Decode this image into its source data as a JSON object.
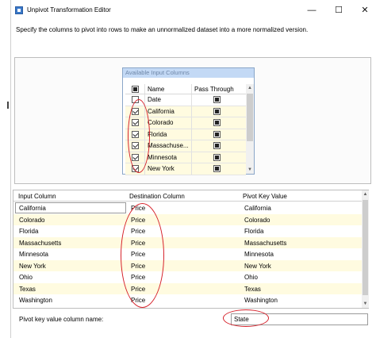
{
  "window": {
    "title": "Unpivot Transformation Editor",
    "minimize": "—",
    "maximize": "☐",
    "close": "✕"
  },
  "description": "Specify the columns to pivot into rows to make an unnormalized dataset into a more normalized version.",
  "available_columns": {
    "title": "Available Input Columns",
    "headers": {
      "name": "Name",
      "pass_through": "Pass Through"
    },
    "rows": [
      {
        "name": "Date",
        "checked": false,
        "pass_through": true
      },
      {
        "name": "California",
        "checked": true,
        "pass_through": true
      },
      {
        "name": "Colorado",
        "checked": true,
        "pass_through": true
      },
      {
        "name": "Florida",
        "checked": true,
        "pass_through": true
      },
      {
        "name": "Massachuse...",
        "checked": true,
        "pass_through": true
      },
      {
        "name": "Minnesota",
        "checked": true,
        "pass_through": true
      },
      {
        "name": "New York",
        "checked": true,
        "pass_through": true
      }
    ]
  },
  "grid": {
    "headers": {
      "input": "Input Column",
      "destination": "Destination Column",
      "pivot": "Pivot Key Value"
    },
    "rows": [
      {
        "input": "California",
        "destination": "Price",
        "pivot": "California"
      },
      {
        "input": "Colorado",
        "destination": "Price",
        "pivot": "Colorado"
      },
      {
        "input": "Florida",
        "destination": "Price",
        "pivot": "Florida"
      },
      {
        "input": "Massachusetts",
        "destination": "Price",
        "pivot": "Massachusetts"
      },
      {
        "input": "Minnesota",
        "destination": "Price",
        "pivot": "Minnesota"
      },
      {
        "input": "New York",
        "destination": "Price",
        "pivot": "New York"
      },
      {
        "input": "Ohio",
        "destination": "Price",
        "pivot": "Ohio"
      },
      {
        "input": "Texas",
        "destination": "Price",
        "pivot": "Texas"
      },
      {
        "input": "Washington",
        "destination": "Price",
        "pivot": "Washington"
      }
    ]
  },
  "pivot_key": {
    "label": "Pivot key value column name:",
    "value": "State"
  },
  "colors": {
    "annotation": "#d6212a",
    "alt_row": "#fffbe0",
    "list_title_bg": "#c3d9f5"
  }
}
